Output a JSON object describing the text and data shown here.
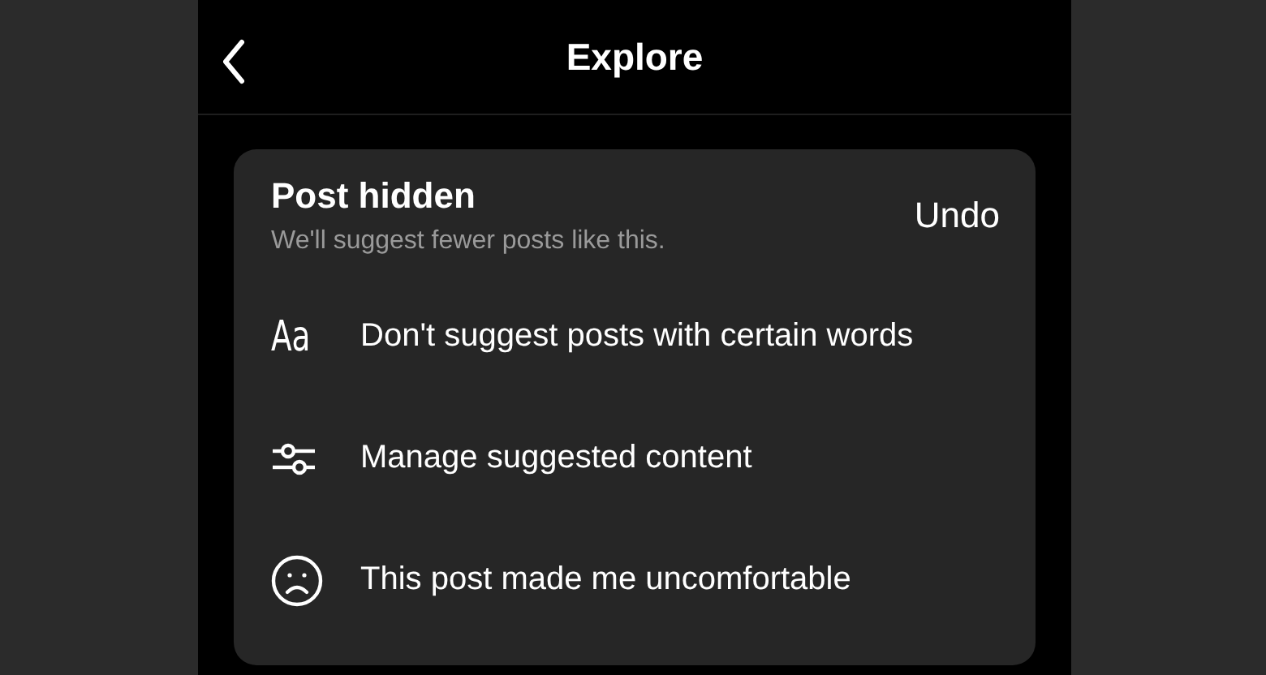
{
  "header": {
    "title": "Explore"
  },
  "card": {
    "title": "Post hidden",
    "subtitle": "We'll suggest fewer posts like this.",
    "action": "Undo",
    "options": [
      {
        "kind": "glyph",
        "glyph": "Aa",
        "label": "Don't suggest posts with certain words"
      },
      {
        "kind": "sliders",
        "label": "Manage suggested content"
      },
      {
        "kind": "sad",
        "label": "This post made me uncomfortable"
      }
    ]
  }
}
